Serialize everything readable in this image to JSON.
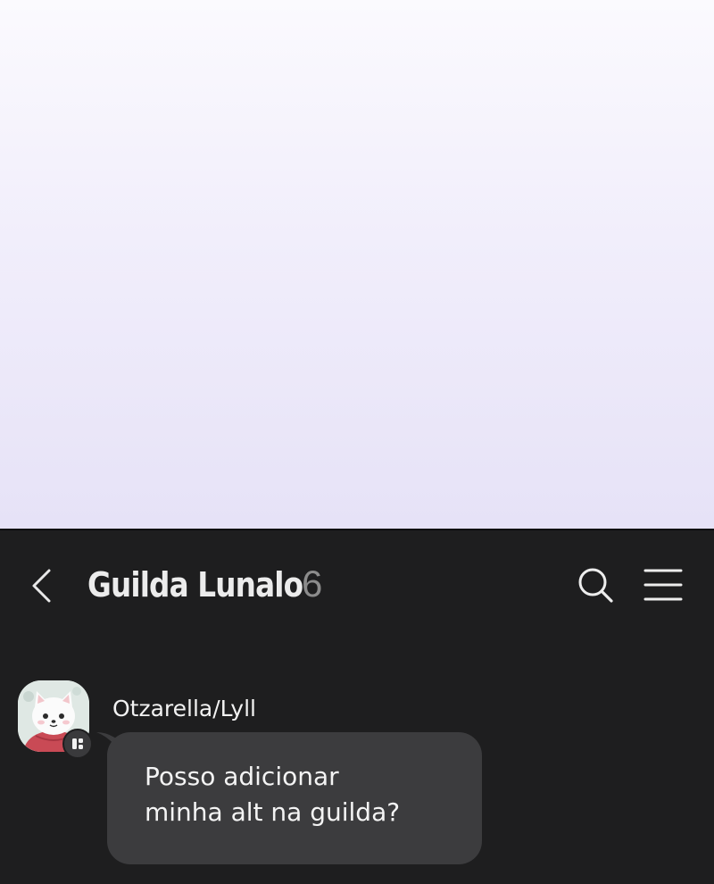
{
  "header": {
    "back_icon": "chevron-left-icon",
    "title": "Guilda Lunalo",
    "member_count": "6",
    "search_icon": "search-icon",
    "menu_icon": "hamburger-menu-icon"
  },
  "messages": [
    {
      "sender": "Otzarella/Lyll",
      "avatar": "white-cat-avatar",
      "badge_icon": "app-badge-icon",
      "text": "Posso adicionar\nminha alt na guilda?"
    }
  ],
  "colors": {
    "chat_background": "#1e1e1f",
    "bubble_background": "#3c3c3e",
    "top_gradient_start": "#fbfafe",
    "top_gradient_end": "#e6e2f7"
  }
}
